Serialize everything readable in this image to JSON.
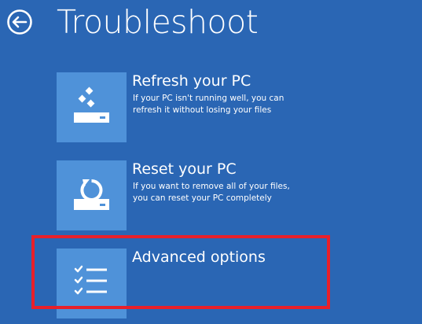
{
  "header": {
    "title": "Troubleshoot",
    "back_icon": "back-arrow-icon"
  },
  "options": [
    {
      "title": "Refresh your PC",
      "description": "If your PC isn't running well, you can\nrefresh it without losing your files",
      "icon": "refresh-pc-icon"
    },
    {
      "title": "Reset your PC",
      "description": "If you want to remove all of your files,\nyou can reset your PC completely",
      "icon": "reset-pc-icon"
    },
    {
      "title": "Advanced options",
      "description": "",
      "icon": "checklist-icon",
      "highlighted": true
    }
  ],
  "colors": {
    "background": "#2a66b4",
    "tile": "#4f92d9",
    "highlight": "#e8202a",
    "text": "#ffffff"
  }
}
